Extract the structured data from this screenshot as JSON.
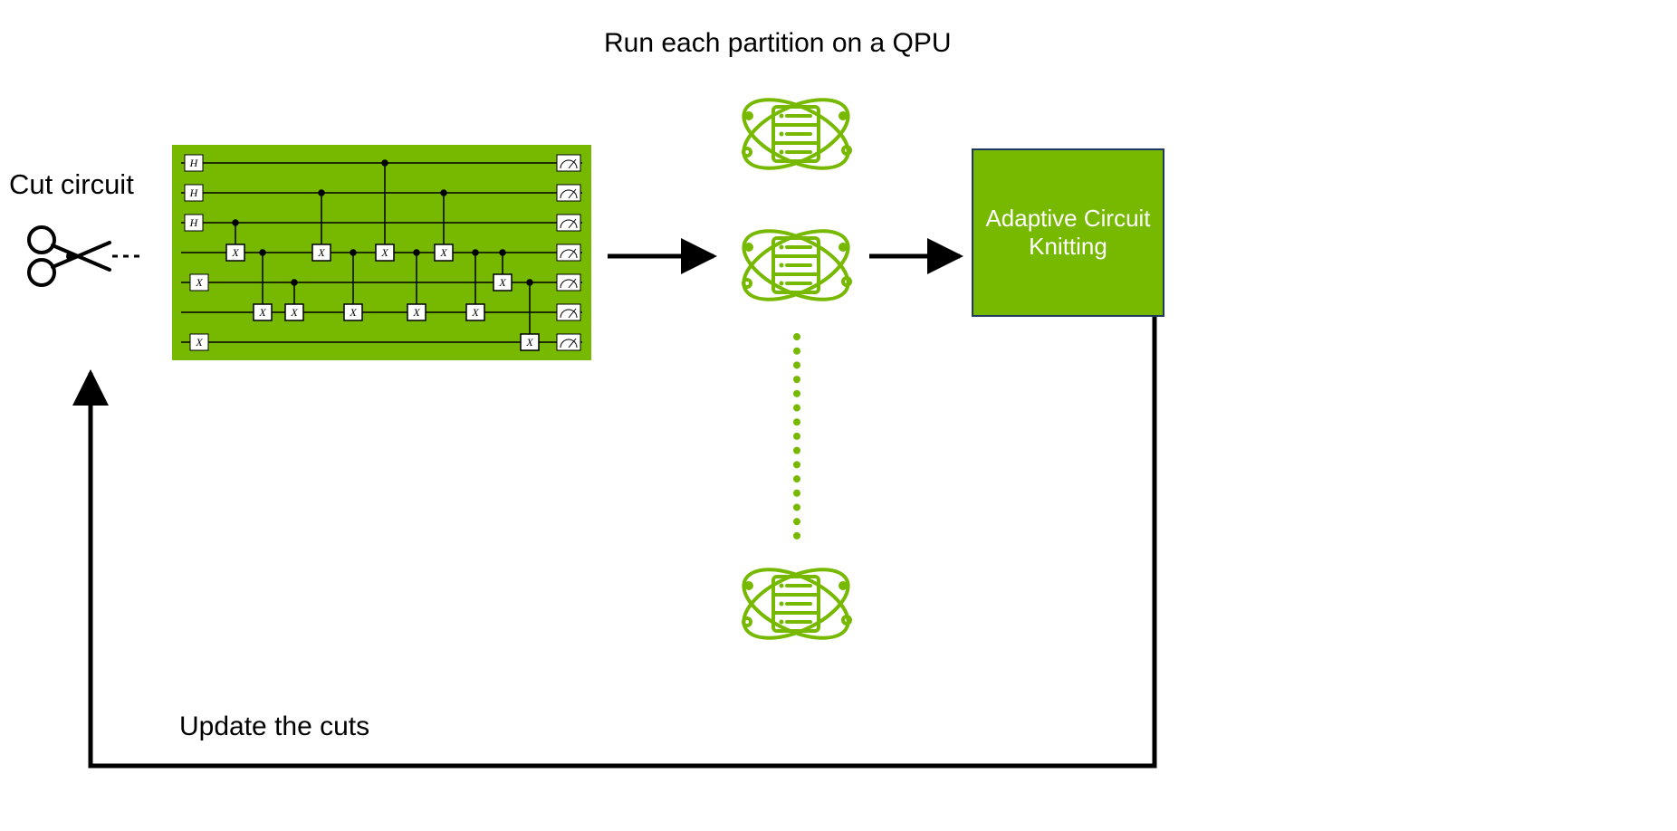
{
  "labels": {
    "cut_circuit": "Cut circuit",
    "run_partition": "Run each partition on a QPU",
    "update_cuts": "Update the cuts",
    "ack_box": "Adaptive Circuit Knitting"
  },
  "colors": {
    "green": "#76b900",
    "dark_border": "#1f3a5f",
    "black": "#000000",
    "white": "#ffffff"
  },
  "icons": {
    "scissors": "scissors-icon",
    "qpu": "quantum-server-icon"
  },
  "circuit": {
    "wires": 7,
    "init_gates": [
      "H",
      "H",
      "H",
      "X",
      "",
      "",
      "X"
    ],
    "x_gate_columns_note": "Quantum circuit schematic with CNOT dots, X gates, and measurement boxes on a green background"
  },
  "flow": [
    "Cut circuit",
    "Run each partition on a QPU (multiple QPUs)",
    "Adaptive Circuit Knitting",
    "Update the cuts (feedback loop back to Cut circuit)"
  ]
}
